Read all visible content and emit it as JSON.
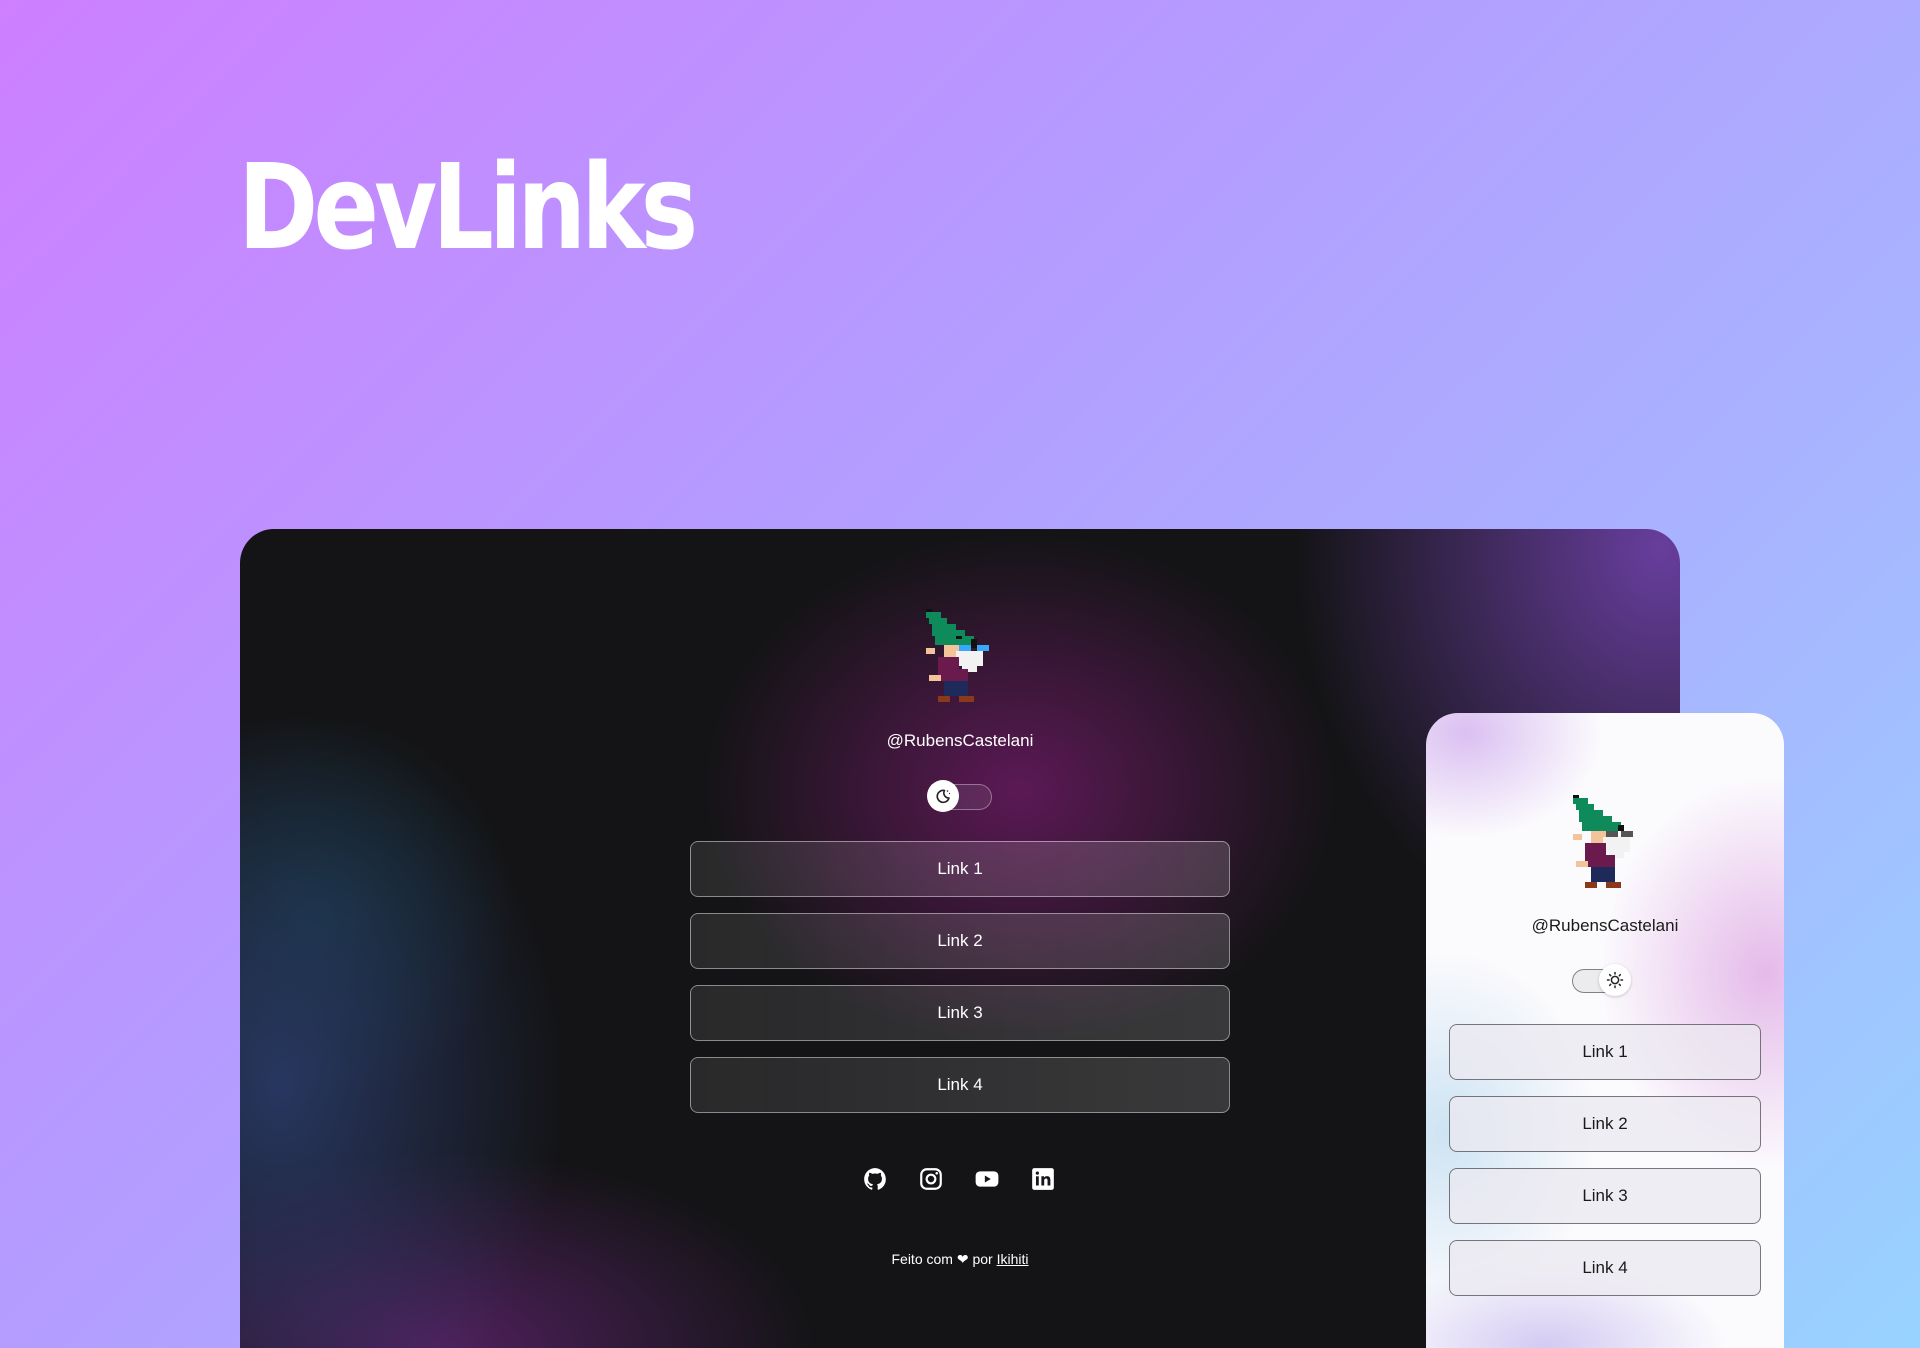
{
  "hero": {
    "title": "DevLinks"
  },
  "desktop": {
    "theme": "dark",
    "handle": "@RubensCastelani",
    "toggle_icon": "moon-icon",
    "links": [
      {
        "label": "Link 1"
      },
      {
        "label": "Link 2"
      },
      {
        "label": "Link 3"
      },
      {
        "label": "Link 4"
      }
    ],
    "socials": [
      {
        "icon": "github-icon"
      },
      {
        "icon": "instagram-icon"
      },
      {
        "icon": "youtube-icon"
      },
      {
        "icon": "linkedin-icon"
      }
    ],
    "footer": {
      "prefix": "Feito com",
      "heart": "❤",
      "connector": "por",
      "author": "Ikihiti"
    }
  },
  "phone": {
    "theme": "light",
    "handle": "@RubensCastelani",
    "toggle_icon": "sun-icon",
    "links": [
      {
        "label": "Link 1"
      },
      {
        "label": "Link 2"
      },
      {
        "label": "Link 3"
      },
      {
        "label": "Link 4"
      }
    ]
  },
  "colors": {
    "background_start": "#cd7fff",
    "background_end": "#98d3ff",
    "desktop_base": "#141416",
    "phone_base": "#fbfafd",
    "gnome_hat": "#0f8a5a"
  }
}
